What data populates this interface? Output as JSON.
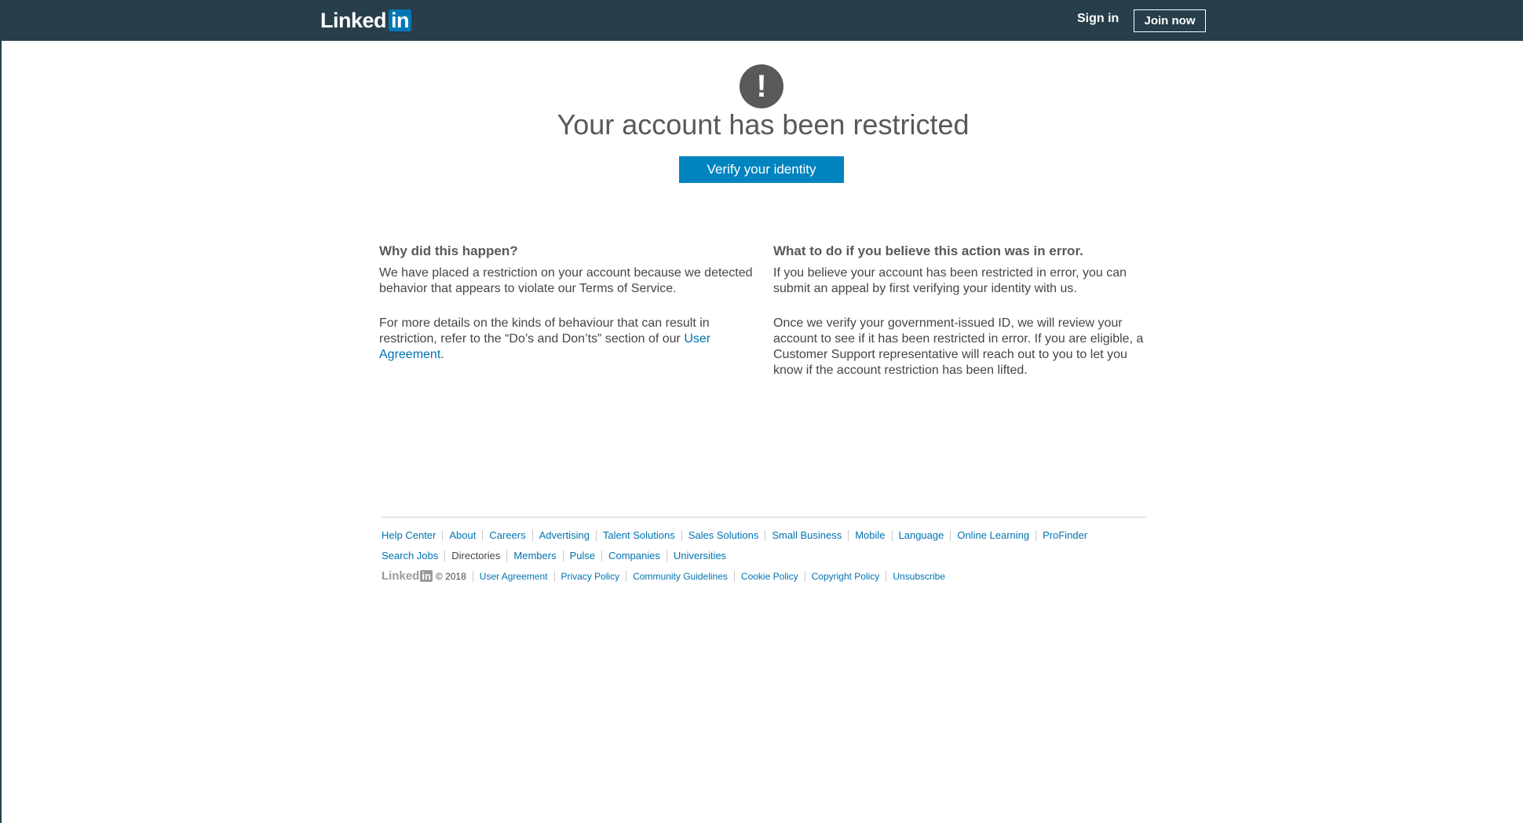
{
  "header": {
    "logo_text": "Linked",
    "logo_box": "in",
    "sign_in": "Sign in",
    "join_now": "Join now"
  },
  "main": {
    "icon_glyph": "!",
    "headline": "Your account has been restricted",
    "verify_button": "Verify your identity"
  },
  "left": {
    "title": "Why did this happen?",
    "p1": "We have placed a restriction on your account because we detected behavior that appears to violate our Terms of Service.",
    "p2_pre": "For more details on the kinds of behaviour that can result in restriction, refer to the “Do’s and Don’ts” section of our ",
    "p2_link": "User Agreement",
    "p2_post": "."
  },
  "right": {
    "title": "What to do if you believe this action was in error.",
    "p1": "If you believe your account has been restricted in error, you can submit an appeal by first verifying your identity with us.",
    "p2": "Once we verify your government-issued ID, we will review your account to see if it has been restricted in error. If you are eligible, a Customer Support representative will reach out to you to let you know if the account restriction has been lifted."
  },
  "footer": {
    "row1": [
      "Help Center",
      "About",
      "Careers",
      "Advertising",
      "Talent Solutions",
      "Sales Solutions",
      "Small Business",
      "Mobile",
      "Language",
      "Online Learning",
      "ProFinder"
    ],
    "row2": [
      "Search Jobs",
      "Directories",
      "Members",
      "Pulse",
      "Companies",
      "Universities"
    ],
    "logo_text": "Linked",
    "logo_box": "in",
    "copyright": "© 2018",
    "row3": [
      "User Agreement",
      "Privacy Policy",
      "Community Guidelines",
      "Cookie Policy",
      "Copyright Policy",
      "Unsubscribe"
    ]
  },
  "colors": {
    "topbar": "#283e4a",
    "brand_blue": "#0077b5",
    "button_blue": "#0084bf",
    "link_blue": "#0073b1"
  }
}
